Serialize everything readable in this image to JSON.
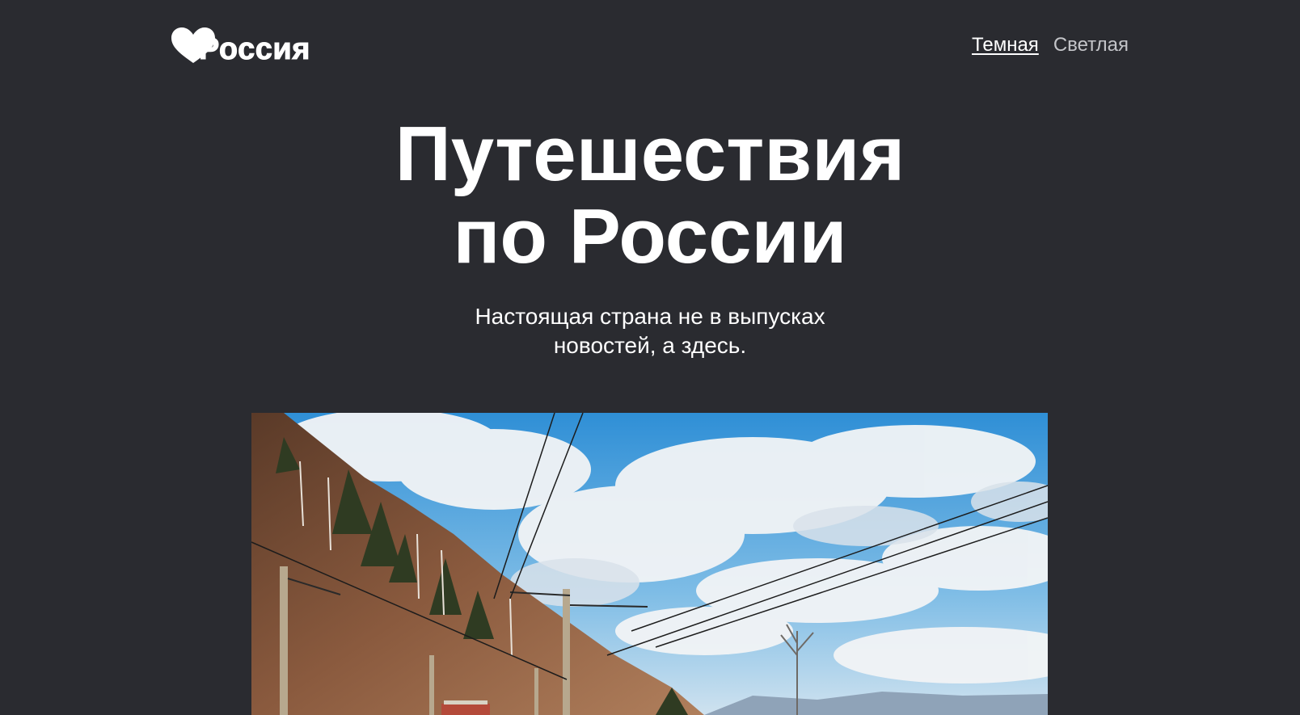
{
  "header": {
    "logo_text": "Россия",
    "logo_icon": "heart-icon",
    "theme_links": [
      {
        "label": "Темная",
        "active": true
      },
      {
        "label": "Светлая",
        "active": false
      }
    ]
  },
  "hero": {
    "title_line1": "Путешествия",
    "title_line2": "по России",
    "subtitle_line1": "Настоящая страна не в выпусках",
    "subtitle_line2": "новостей, а здесь."
  },
  "colors": {
    "background": "#2a2b30",
    "text": "#ffffff",
    "inactive_link": "#c3c4c8",
    "sky": "#3a9ad9"
  }
}
